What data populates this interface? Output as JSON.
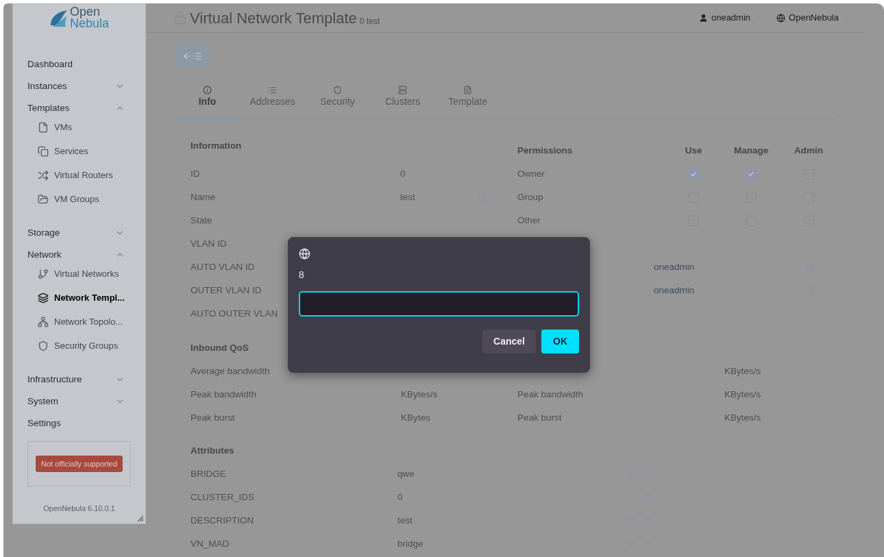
{
  "logo": {
    "line_1": "Open",
    "line_2": "Nebula"
  },
  "header": {
    "title": "Virtual Network Template",
    "subtitle": "0 test",
    "user": "oneadmin",
    "zone": "OpenNebula"
  },
  "sidebar": {
    "items": [
      {
        "label": "Dashboard",
        "selected": false
      },
      {
        "label": "Instances",
        "expanded": false,
        "selected": false
      },
      {
        "label": "Templates",
        "expanded": true,
        "selected": false,
        "children": [
          {
            "label": "VMs",
            "selected": false
          },
          {
            "label": "Services",
            "selected": false
          },
          {
            "label": "Virtual Routers",
            "selected": false
          },
          {
            "label": "VM Groups",
            "selected": false
          }
        ]
      },
      {
        "label": "Storage",
        "expanded": false,
        "selected": false
      },
      {
        "label": "Network",
        "expanded": true,
        "selected": false,
        "children": [
          {
            "label": "Virtual Networks",
            "selected": false
          },
          {
            "label": "Network Templ...",
            "selected": true
          },
          {
            "label": "Network Topolo...",
            "selected": false
          },
          {
            "label": "Security Groups",
            "selected": false
          }
        ]
      },
      {
        "label": "Infrastructure",
        "expanded": false,
        "selected": false
      },
      {
        "label": "System",
        "expanded": false,
        "selected": false
      },
      {
        "label": "Settings",
        "selected": false
      }
    ],
    "badge": "Not officially supported",
    "version": "OpenNebula 6.10.0.1"
  },
  "tabs": [
    {
      "label": "Info",
      "selected": true
    },
    {
      "label": "Addresses",
      "selected": false
    },
    {
      "label": "Security",
      "selected": false
    },
    {
      "label": "Clusters",
      "selected": false
    },
    {
      "label": "Template",
      "selected": false
    }
  ],
  "information": {
    "title": "Information",
    "rows": [
      {
        "label": "ID",
        "value": "0",
        "editable": false
      },
      {
        "label": "Name",
        "value": "test",
        "editable": true
      },
      {
        "label": "State",
        "editable": false
      },
      {
        "label": "VLAN ID",
        "editable": false
      },
      {
        "label": "AUTO VLAN ID",
        "editable": false
      },
      {
        "label": "OUTER VLAN ID",
        "editable": false
      },
      {
        "label": "AUTO OUTER VLAN",
        "editable": false
      }
    ]
  },
  "permissions": {
    "title": "Permissions",
    "columns": [
      "Use",
      "Manage",
      "Admin"
    ],
    "rows": [
      {
        "label": "Owner",
        "checked": [
          true,
          true,
          false
        ]
      },
      {
        "label": "Group",
        "checked": [
          false,
          false,
          false
        ]
      },
      {
        "label": "Other",
        "checked": [
          false,
          false,
          false
        ]
      }
    ]
  },
  "ownership": {
    "rows": [
      {
        "value": "oneadmin"
      },
      {
        "value": "oneadmin"
      }
    ]
  },
  "inbound_qos": {
    "title": "Inbound QoS",
    "rows": [
      {
        "label": "Average bandwidth"
      },
      {
        "label": "Peak bandwidth",
        "unit": "KBytes/s"
      },
      {
        "label": "Peak burst",
        "unit": "KBytes"
      }
    ]
  },
  "outbound_qos": {
    "rows": [
      {
        "unit": "KBytes/s"
      },
      {
        "label": "Peak bandwidth",
        "unit": "KBytes/s"
      },
      {
        "label": "Peak burst",
        "unit": "KBytes/s"
      }
    ]
  },
  "attributes": {
    "title": "Attributes",
    "rows": [
      {
        "name": "BRIDGE",
        "value": "qwe"
      },
      {
        "name": "CLUSTER_IDS",
        "value": "0"
      },
      {
        "name": "DESCRIPTION",
        "value": "test"
      },
      {
        "name": "VN_MAD",
        "value": "bridge"
      }
    ]
  },
  "dialog": {
    "message": "8",
    "buttons": [
      {
        "label": "Cancel",
        "kind": "secondary"
      },
      {
        "label": "OK",
        "kind": "primary"
      }
    ]
  }
}
